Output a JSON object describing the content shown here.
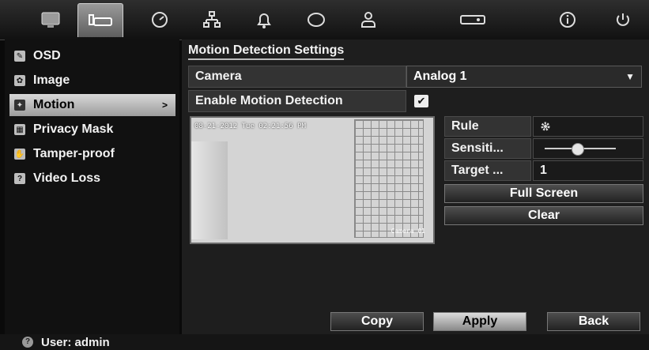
{
  "topbar": {
    "tabs": [
      {
        "icon": "monitor-icon"
      },
      {
        "icon": "camera-icon",
        "active": true
      },
      {
        "icon": "clock-icon"
      },
      {
        "icon": "network-icon"
      },
      {
        "icon": "bell-icon"
      },
      {
        "icon": "hdd-icon"
      },
      {
        "icon": "user-icon"
      },
      {
        "icon": "device-icon"
      },
      {
        "icon": "info-icon"
      },
      {
        "icon": "power-icon"
      }
    ]
  },
  "sidebar": {
    "items": [
      {
        "label": "OSD",
        "icon": "osd-icon"
      },
      {
        "label": "Image",
        "icon": "image-icon"
      },
      {
        "label": "Motion",
        "icon": "motion-icon",
        "active": true,
        "arrow": ">"
      },
      {
        "label": "Privacy Mask",
        "icon": "privacy-mask-icon"
      },
      {
        "label": "Tamper-proof",
        "icon": "tamper-icon"
      },
      {
        "label": "Video Loss",
        "icon": "video-loss-icon"
      }
    ]
  },
  "main": {
    "title": "Motion Detection Settings",
    "camera_label": "Camera",
    "camera_value": "Analog 1",
    "enable_label": "Enable Motion Detection",
    "enable_checked": true,
    "check_glyph": "✔",
    "preview": {
      "timestamp": "08-21-2012 Tue 02:21:56 PM",
      "camera_overlay": "Camera 01"
    },
    "params": {
      "rule_label": "Rule",
      "sensitivity_label": "Sensiti...",
      "sensitivity_level": 0.45,
      "target_label": "Target ...",
      "target_value": "1"
    },
    "buttons": {
      "full_screen": "Full Screen",
      "clear": "Clear",
      "copy": "Copy",
      "apply": "Apply",
      "back": "Back"
    }
  },
  "status": {
    "user_text": "User: admin"
  }
}
